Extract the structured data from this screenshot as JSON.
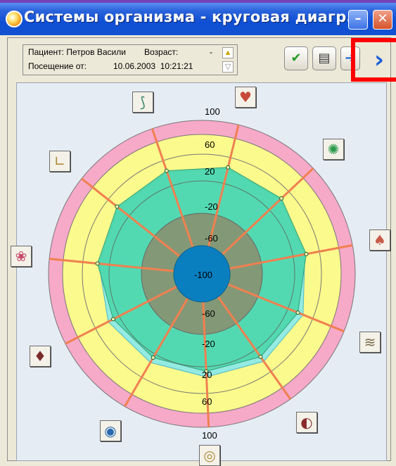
{
  "window": {
    "title": "Системы организма - круговая диагр...",
    "minimize_glyph": "–",
    "close_glyph": "✕"
  },
  "patient": {
    "label": "Пациент:",
    "name": "Петров Васили",
    "age_label": "Возраст:",
    "age_value": "-",
    "visit_label": "Посещение от:",
    "visit_date": "10.06.2003",
    "visit_time": "10:21:21"
  },
  "toolbar": {
    "buttons": [
      {
        "name": "check-icon",
        "glyph": "✔"
      },
      {
        "name": "notes-icon",
        "glyph": "▤"
      },
      {
        "name": "export-icon",
        "glyph": "➔"
      }
    ],
    "next_glyph": "›"
  },
  "chart_data": {
    "type": "radar",
    "ring_labels_top": [
      "100",
      "60",
      "20",
      "-20",
      "-60"
    ],
    "center_label": "-100",
    "ring_labels_bottom": [
      "-60",
      "-20",
      "20",
      "60",
      "100"
    ],
    "scale": [
      -100,
      -60,
      -20,
      20,
      60,
      100
    ],
    "colors": {
      "outer": "#f7a9c8",
      "mid": "#fbfa8c",
      "inner": "#48d6a8",
      "core": "#8c8c6c",
      "center": "#0a7fc0",
      "spoke": "#f08050",
      "series_cyan": "#80e8f0"
    },
    "systems": [
      {
        "name": "spine-icon",
        "value": 4
      },
      {
        "name": "heart-icon",
        "value": 5
      },
      {
        "name": "nerve-cell-icon",
        "value": 5
      },
      {
        "name": "lungs-icon",
        "value": 0
      },
      {
        "name": "intestine-icon",
        "value": -4
      },
      {
        "name": "kidney-icon",
        "value": -7
      },
      {
        "name": "ear-icon",
        "value": -13
      },
      {
        "name": "eye-icon",
        "value": -14
      },
      {
        "name": "thyroid-icon",
        "value": -10
      },
      {
        "name": "brain-icon",
        "value": -2
      },
      {
        "name": "joint-icon",
        "value": 3
      }
    ]
  }
}
